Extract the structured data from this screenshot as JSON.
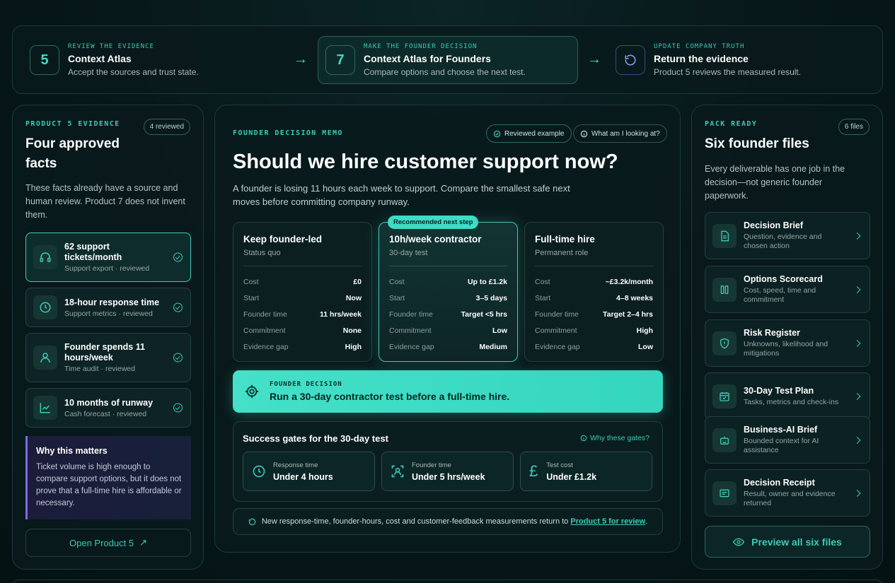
{
  "stepper": {
    "steps": [
      {
        "num": "5",
        "eyebrow": "REVIEW THE EVIDENCE",
        "title": "Context Atlas",
        "sub": "Accept the sources and trust state."
      },
      {
        "num": "7",
        "eyebrow": "MAKE THE FOUNDER DECISION",
        "title": "Context Atlas for Founders",
        "sub": "Compare options and choose the next test."
      },
      {
        "icon": "refresh-icon",
        "eyebrow": "UPDATE COMPANY TRUTH",
        "title": "Return the evidence",
        "sub": "Product 5 reviews the measured result."
      }
    ]
  },
  "left": {
    "eyebrow": "PRODUCT 5 EVIDENCE",
    "badge": "4 reviewed",
    "title_line1": "Four approved",
    "title_line2": "facts",
    "desc": "These facts already have a source and human review. Product 7 does not invent them.",
    "facts": [
      {
        "icon": "headset-icon",
        "title": "62 support tickets/month",
        "sub": "Support export · reviewed"
      },
      {
        "icon": "clock-icon",
        "title": "18-hour response time",
        "sub": "Support metrics · reviewed"
      },
      {
        "icon": "user-icon",
        "title": "Founder spends 11 hours/week",
        "sub": "Time audit · reviewed"
      },
      {
        "icon": "chart-icon",
        "title": "10 months of runway",
        "sub": "Cash forecast · reviewed"
      }
    ],
    "why_title": "Why this matters",
    "why_text": "Ticket volume is high enough to compare support options, but it does not prove that a full-time hire is affordable or necessary.",
    "open_button": "Open Product 5",
    "open_icon": "↗"
  },
  "center": {
    "eyebrow": "FOUNDER DECISION MEMO",
    "reviewed_pill": "Reviewed example",
    "info_pill": "What am I looking at?",
    "title": "Should we hire customer support now?",
    "desc": "A founder is losing 11 hours each week to support. Compare the smallest safe next moves before committing company runway.",
    "recommended_tag": "Recommended next step",
    "options": [
      {
        "title": "Keep founder-led",
        "sub": "Status quo",
        "rows": [
          [
            "Cost",
            "£0"
          ],
          [
            "Start",
            "Now"
          ],
          [
            "Founder time",
            "11 hrs/week"
          ],
          [
            "Commitment",
            "None"
          ],
          [
            "Evidence gap",
            "High"
          ]
        ]
      },
      {
        "title": "10h/week contractor",
        "sub": "30-day test",
        "rows": [
          [
            "Cost",
            "Up to £1.2k"
          ],
          [
            "Start",
            "3–5 days"
          ],
          [
            "Founder time",
            "Target <5 hrs"
          ],
          [
            "Commitment",
            "Low"
          ],
          [
            "Evidence gap",
            "Medium"
          ]
        ]
      },
      {
        "title": "Full-time hire",
        "sub": "Permanent role",
        "rows": [
          [
            "Cost",
            "~£3.2k/month"
          ],
          [
            "Start",
            "4–8 weeks"
          ],
          [
            "Founder time",
            "Target 2–4 hrs"
          ],
          [
            "Commitment",
            "High"
          ],
          [
            "Evidence gap",
            "Low"
          ]
        ]
      }
    ],
    "decision_eyebrow": "FOUNDER DECISION",
    "decision_text": "Run a 30-day contractor test before a full-time hire.",
    "gates_title": "Success gates for the 30-day test",
    "gates_link": "Why these gates?",
    "gates": [
      {
        "icon": "clock-icon",
        "label": "Response time",
        "value": "Under 4 hours"
      },
      {
        "icon": "user-focus-icon",
        "label": "Founder time",
        "value": "Under 5 hrs/week"
      },
      {
        "icon": "pound-icon",
        "label": "Test cost",
        "value": "Under £1.2k"
      }
    ],
    "note_text": "New response-time, founder-hours, cost and customer-feedback measurements return to",
    "note_link": "Product 5 for review",
    "note_end": "."
  },
  "right": {
    "eyebrow": "PACK READY",
    "badge": "6 files",
    "title": "Six founder files",
    "desc": "Every deliverable has one job in the decision—not generic founder paperwork.",
    "files": [
      {
        "icon": "document-icon",
        "title": "Decision Brief",
        "sub": "Question, evidence and chosen action"
      },
      {
        "icon": "columns-icon",
        "title": "Options Scorecard",
        "sub": "Cost, speed, time and commitment"
      },
      {
        "icon": "shield-alert-icon",
        "title": "Risk Register",
        "sub": "Unknowns, likelihood and mitigations"
      },
      {
        "icon": "calendar-check-icon",
        "title": "30-Day Test Plan",
        "sub": "Tasks, metrics and check-ins"
      },
      {
        "icon": "robot-icon",
        "title": "Business-AI Brief",
        "sub": "Bounded context for AI assistance"
      },
      {
        "icon": "receipt-icon",
        "title": "Decision Receipt",
        "sub": "Result, owner and evidence returned"
      }
    ],
    "preview_button": "Preview all six files"
  },
  "colors": {
    "accent": "#3ddcc4",
    "purple": "#7b6cf0",
    "bg": "#07181a"
  }
}
